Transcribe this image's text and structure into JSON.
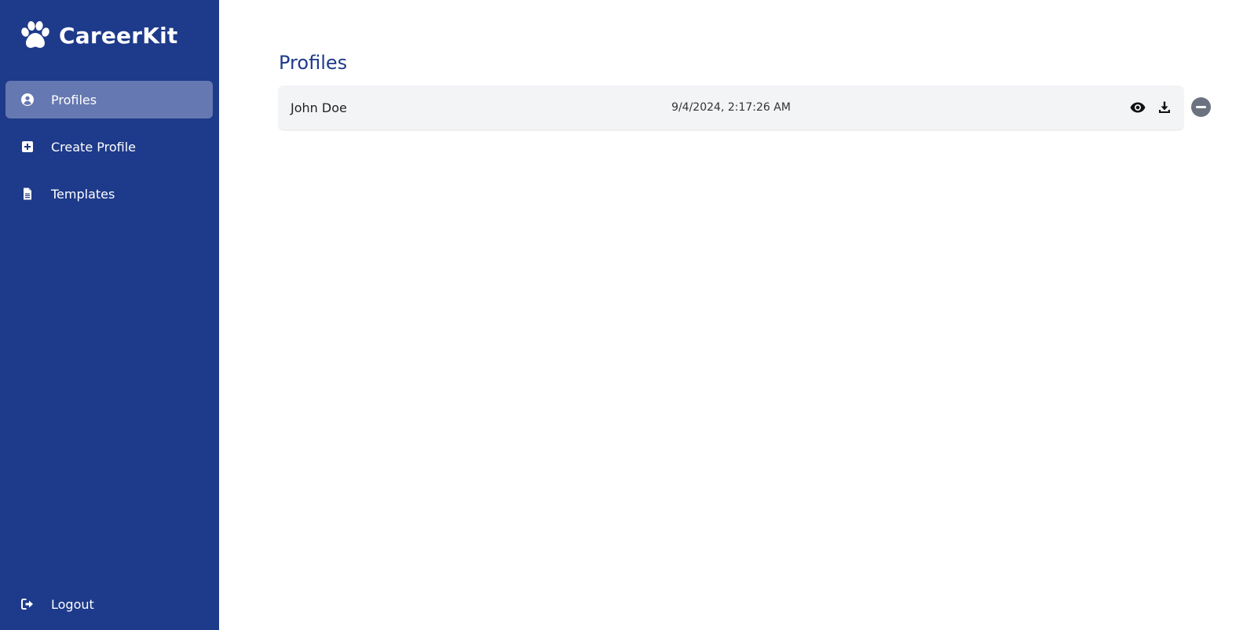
{
  "brand": {
    "name": "CareerKit",
    "icon": "paw-icon"
  },
  "sidebar": {
    "items": [
      {
        "label": "Profiles",
        "icon": "user-circle-icon",
        "active": true
      },
      {
        "label": "Create Profile",
        "icon": "plus-square-icon",
        "active": false
      },
      {
        "label": "Templates",
        "icon": "file-icon",
        "active": false
      }
    ],
    "logout": {
      "label": "Logout",
      "icon": "sign-out-icon"
    }
  },
  "main": {
    "title": "Profiles",
    "profiles": [
      {
        "name": "John Doe",
        "date": "9/4/2024, 2:17:26 AM",
        "actions": [
          "eye-icon",
          "download-icon"
        ],
        "remove_icon": "minus-circle-icon"
      }
    ]
  },
  "colors": {
    "sidebar_bg": "#1e3a8a",
    "active_item_bg": "#6678b1",
    "title_color": "#1e3a8a",
    "row_bg": "#f3f4f6",
    "remove_btn_bg": "#6b7280"
  }
}
